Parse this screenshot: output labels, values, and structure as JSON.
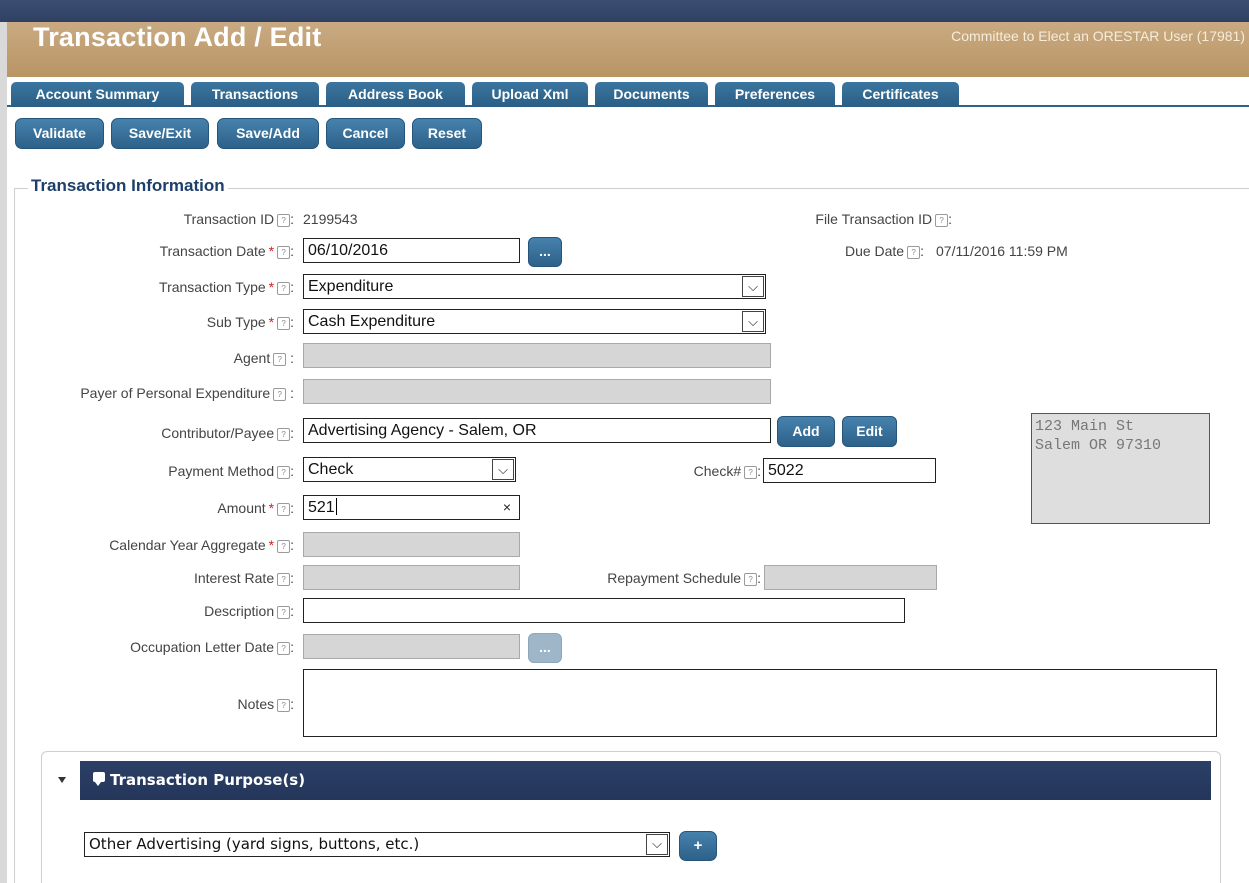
{
  "header": {
    "title": "Transaction Add / Edit",
    "committee": "Committee to Elect an ORESTAR User (17981)"
  },
  "tabs": [
    "Account Summary",
    "Transactions",
    "Address Book",
    "Upload Xml",
    "Documents",
    "Preferences",
    "Certificates"
  ],
  "toolbar": [
    "Validate",
    "Save/Exit",
    "Save/Add",
    "Cancel",
    "Reset"
  ],
  "section_title": "Transaction Information",
  "labels": {
    "transaction_id": "Transaction ID",
    "file_transaction_id": "File Transaction ID",
    "transaction_date": "Transaction Date",
    "due_date": "Due Date",
    "transaction_type": "Transaction Type",
    "sub_type": "Sub Type",
    "agent": "Agent",
    "payer": "Payer of Personal Expenditure",
    "contributor": "Contributor/Payee",
    "payment_method": "Payment Method",
    "check": "Check#",
    "amount": "Amount",
    "aggregate": "Calendar Year Aggregate",
    "interest_rate": "Interest Rate",
    "repayment": "Repayment Schedule",
    "description": "Description",
    "occupation_date": "Occupation Letter Date",
    "notes": "Notes"
  },
  "values": {
    "transaction_id": "2199543",
    "transaction_date": "06/10/2016",
    "due_date": "07/11/2016 11:59 PM",
    "transaction_type": "Expenditure",
    "sub_type": "Cash Expenditure",
    "contributor": "Advertising Agency - Salem, OR",
    "payment_method": "Check",
    "check": "5022",
    "amount": "521",
    "address_line1": "123 Main St",
    "address_line2": "Salem OR 97310"
  },
  "buttons": {
    "calendar": "...",
    "add": "Add",
    "edit": "Edit",
    "plus": "+",
    "clear": "×"
  },
  "purpose": {
    "title": "Transaction Purpose(s)",
    "selected": "Other Advertising (yard signs, buttons, etc.)"
  },
  "colors": {
    "accent": "#2d6189",
    "header_tan": "#b99565",
    "navy": "#24365a",
    "required": "#d02020"
  }
}
